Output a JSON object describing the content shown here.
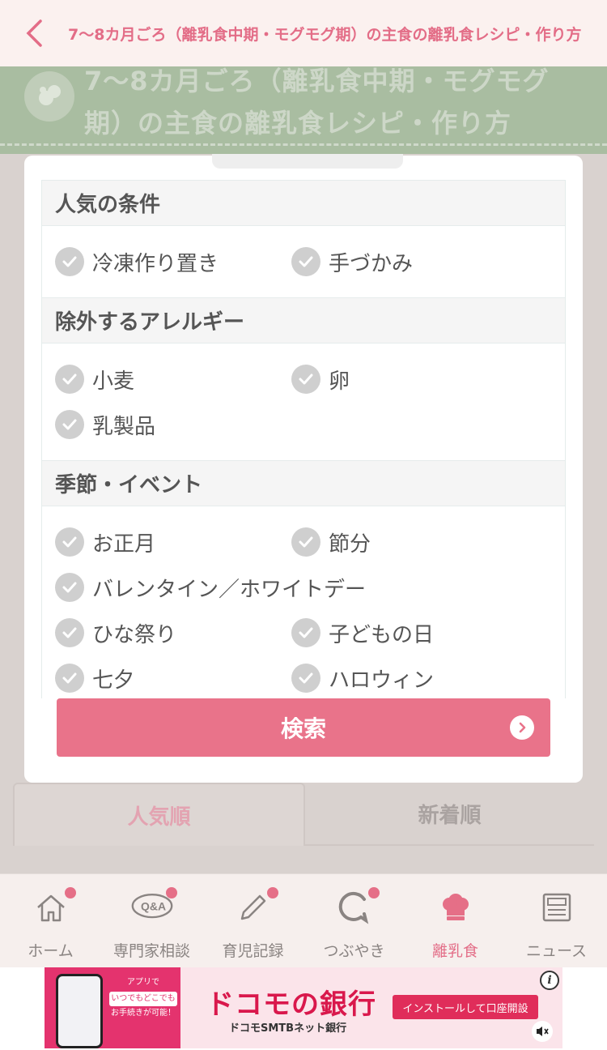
{
  "header": {
    "title": "7〜8カ月ごろ（離乳食中期・モグモグ期）の主食の離乳食レシピ・作り方"
  },
  "banner": {
    "title": "7〜8カ月ごろ（離乳食中期・モグモグ期）の主食の離乳食レシピ・作り方"
  },
  "filter": {
    "sections": [
      {
        "title": "人気の条件",
        "options": [
          "冷凍作り置き",
          "手づかみ"
        ]
      },
      {
        "title": "除外するアレルギー",
        "options": [
          "小麦",
          "卵",
          "乳製品"
        ]
      },
      {
        "title": "季節・イベント",
        "options": [
          "お正月",
          "節分",
          "バレンタイン／ホワイトデー",
          "ひな祭り",
          "子どもの日",
          "七夕",
          "ハロウィン"
        ]
      }
    ],
    "search_label": "検索"
  },
  "sort_tabs": [
    "人気順",
    "新着順"
  ],
  "nav": {
    "items": [
      {
        "label": "ホーム",
        "icon": "home-icon"
      },
      {
        "label": "専門家相談",
        "icon": "qa-icon"
      },
      {
        "label": "育児記録",
        "icon": "pencil-icon"
      },
      {
        "label": "つぶやき",
        "icon": "chat-icon"
      },
      {
        "label": "離乳食",
        "icon": "chef-hat-icon"
      },
      {
        "label": "ニュース",
        "icon": "news-icon"
      }
    ]
  },
  "ad": {
    "brand": "ドコモの銀行",
    "sub": "ドコモSMTBネット銀行",
    "cta": "インストールして口座開設",
    "phone_line1": "アプリで",
    "phone_line2": "いつでもどこでも",
    "phone_line3": "お手続きが可能！"
  },
  "colors": {
    "accent": "#e9738a",
    "banner": "#a9bda1",
    "check": "#cfcfcf"
  }
}
